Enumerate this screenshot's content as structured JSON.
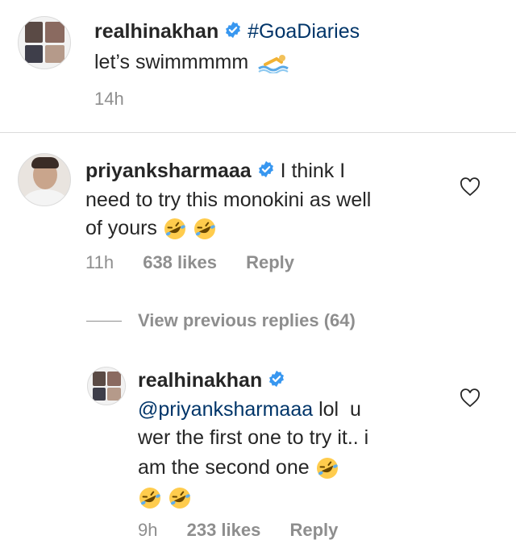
{
  "post": {
    "username": "realhinakhan",
    "hashtag": "#GoaDiaries",
    "caption": "let’s swimmmmm",
    "caption_emoji": "swimmer-icon",
    "time": "14h"
  },
  "comment": {
    "username": "priyanksharmaaa",
    "text_line1": "I think I",
    "text_line2": "need to try this monokini as well",
    "text_line3": "of yours",
    "emoji": "rolling-on-floor-laughing-icon",
    "time": "11h",
    "likes": "638 likes",
    "reply_label": "Reply"
  },
  "view_previous": "View previous replies (64)",
  "reply": {
    "username": "realhinakhan",
    "mention": "@priyanksharmaaa",
    "text_line1_rest": " lol  u",
    "text_line2": "wer the first one to try it.. i",
    "text_line3": "am the second one",
    "emoji": "rolling-on-floor-laughing-icon",
    "time": "9h",
    "likes": "233 likes",
    "reply_label": "Reply"
  },
  "colors": {
    "verified": "#3897f0",
    "hashtag": "#003569",
    "meta": "#8e8e8e",
    "divider": "#dbdbdb",
    "emoji_face": "#ffcc4d"
  }
}
